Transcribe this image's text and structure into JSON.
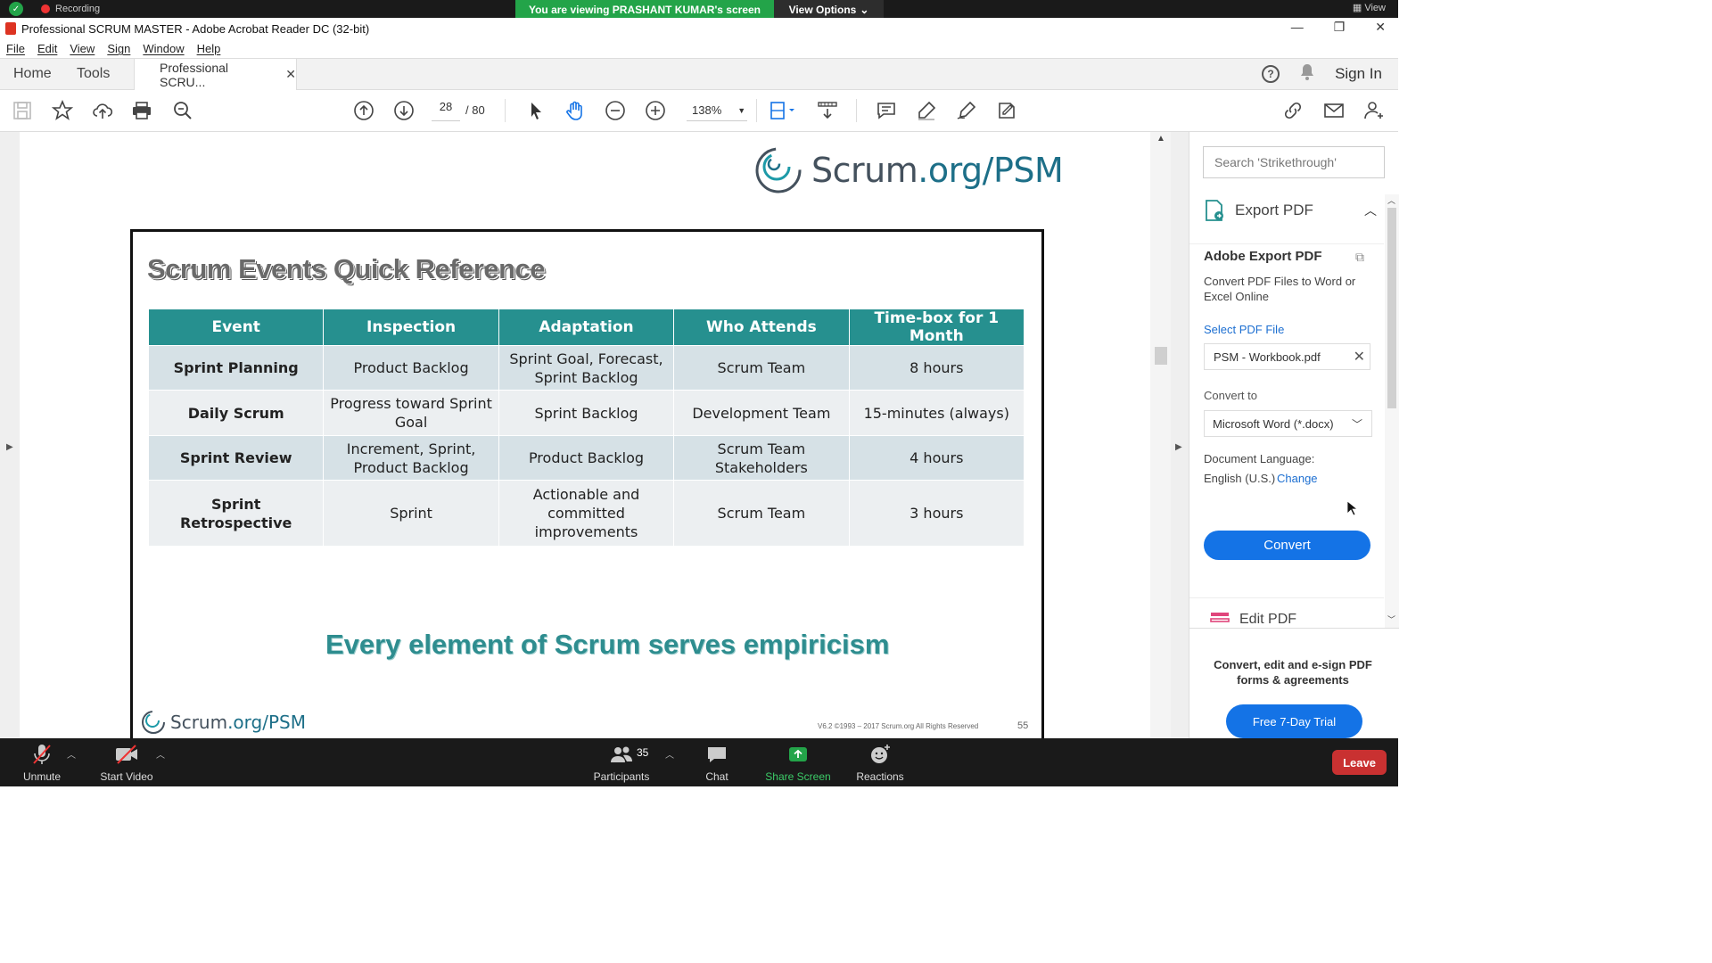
{
  "zoom_top": {
    "viewing_banner": "You are viewing PRASHANT KUMAR's screen",
    "view_options": "View Options",
    "recording_label": "Recording",
    "view_button": "View"
  },
  "window": {
    "title": "Professional  SCRUM MASTER - Adobe Acrobat Reader DC (32-bit)"
  },
  "menu": [
    "File",
    "Edit",
    "View",
    "Sign",
    "Window",
    "Help"
  ],
  "tabs": {
    "home": "Home",
    "tools": "Tools",
    "document": "Professional  SCRU...",
    "sign_in": "Sign In"
  },
  "toolbar": {
    "page_current": "28",
    "page_total": "/ 80",
    "zoom": "138%"
  },
  "slide": {
    "logo_prefix": "Scrum",
    "logo_suffix": ".org/PSM",
    "title": "Scrum Events Quick Reference",
    "table": {
      "headers": [
        "Event",
        "Inspection",
        "Adaptation",
        "Who Attends",
        "Time-box for 1 Month"
      ],
      "rows": [
        [
          "Sprint Planning",
          "Product Backlog",
          "Sprint Goal, Forecast, Sprint Backlog",
          "Scrum Team",
          "8 hours"
        ],
        [
          "Daily Scrum",
          "Progress toward Sprint Goal",
          "Sprint Backlog",
          "Development Team",
          "15-minutes (always)"
        ],
        [
          "Sprint Review",
          "Increment, Sprint, Product Backlog",
          "Product Backlog",
          "Scrum Team Stakeholders",
          "4 hours"
        ],
        [
          "Sprint Retrospective",
          "Sprint",
          "Actionable and committed improvements",
          "Scrum Team",
          "3 hours"
        ]
      ]
    },
    "tagline": "Every element of Scrum serves empiricism",
    "copyright": "V6.2 ©1993 – 2017 Scrum.org All Rights Reserved",
    "slide_number": "55"
  },
  "right_panel": {
    "search_placeholder": "Search 'Strikethrough'",
    "export_header": "Export PDF",
    "adobe_export_title": "Adobe Export PDF",
    "adobe_export_desc": "Convert PDF Files to Word or Excel Online",
    "select_pdf_label": "Select PDF File",
    "file_name": "PSM - Workbook.pdf",
    "convert_to_label": "Convert to",
    "format_value": "Microsoft Word (*.docx)",
    "doc_lang_label": "Document Language:",
    "doc_lang_value": "English (U.S.)",
    "doc_lang_change": "Change",
    "convert_button": "Convert",
    "edit_pdf": "Edit PDF",
    "promo_text": "Convert, edit and e-sign PDF forms & agreements",
    "trial_button": "Free 7-Day Trial"
  },
  "zoom_bottom": {
    "unmute": "Unmute",
    "start_video": "Start Video",
    "participants": "Participants",
    "participants_count": "35",
    "chat": "Chat",
    "share_screen": "Share Screen",
    "reactions": "Reactions",
    "leave": "Leave"
  },
  "colors": {
    "table_header": "#26908f",
    "accent_blue": "#1473e6",
    "share_green": "#23a449",
    "leave_red": "#c93131"
  }
}
